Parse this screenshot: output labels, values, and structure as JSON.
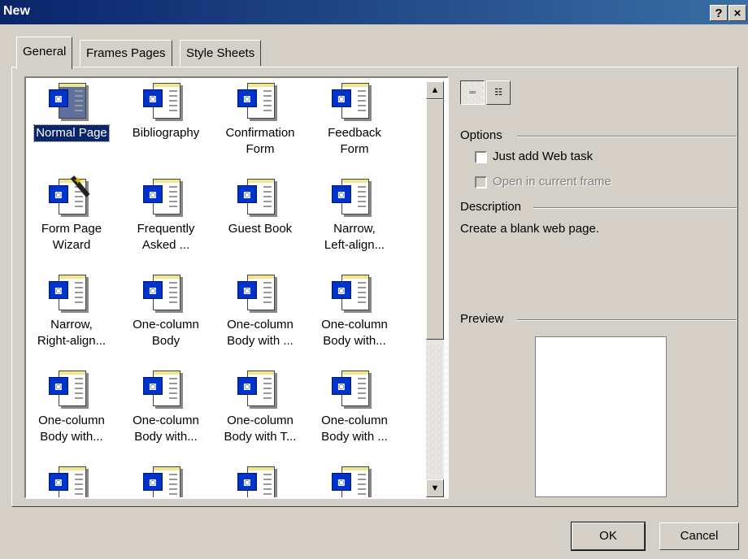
{
  "window": {
    "title": "New",
    "help_label": "?",
    "close_label": "×"
  },
  "tabs": [
    {
      "label": "General",
      "active": true
    },
    {
      "label": "Frames Pages",
      "active": false
    },
    {
      "label": "Style Sheets",
      "active": false
    }
  ],
  "templates": [
    {
      "label": "Normal Page",
      "selected": true,
      "icon": "normal-page-icon"
    },
    {
      "label": "Bibliography",
      "icon": "page-template-icon"
    },
    {
      "label": "Confirmation\nForm",
      "icon": "page-template-icon"
    },
    {
      "label": "Feedback\nForm",
      "icon": "page-template-icon"
    },
    {
      "label": "Form Page\nWizard",
      "icon": "wizard-icon"
    },
    {
      "label": "Frequently\nAsked ...",
      "icon": "page-template-icon"
    },
    {
      "label": "Guest Book",
      "icon": "page-template-icon"
    },
    {
      "label": "Narrow,\nLeft-align...",
      "icon": "page-template-icon"
    },
    {
      "label": "Narrow,\nRight-align...",
      "icon": "page-template-icon"
    },
    {
      "label": "One-column\nBody",
      "icon": "page-template-icon"
    },
    {
      "label": "One-column\nBody with ...",
      "icon": "page-template-icon"
    },
    {
      "label": "One-column\nBody with...",
      "icon": "page-template-icon"
    },
    {
      "label": "One-column\nBody with...",
      "icon": "page-template-icon"
    },
    {
      "label": "One-column\nBody with...",
      "icon": "page-template-icon"
    },
    {
      "label": "One-column\nBody with T...",
      "icon": "page-template-icon"
    },
    {
      "label": "One-column\nBody with ...",
      "icon": "page-template-icon"
    },
    {
      "label": "",
      "icon": "page-template-icon"
    },
    {
      "label": "",
      "icon": "page-template-icon"
    },
    {
      "label": "",
      "icon": "page-template-icon"
    },
    {
      "label": "",
      "icon": "page-template-icon"
    }
  ],
  "view_buttons": {
    "large_icons": "large-icons-view-icon",
    "details": "details-view-icon"
  },
  "options": {
    "heading": "Options",
    "just_add_web_task": {
      "label": "Just add Web task",
      "checked": false,
      "enabled": true
    },
    "open_in_current_frame": {
      "label": "Open in current frame",
      "checked": false,
      "enabled": false
    }
  },
  "description": {
    "heading": "Description",
    "text": "Create a blank web page."
  },
  "preview": {
    "heading": "Preview"
  },
  "buttons": {
    "ok": "OK",
    "cancel": "Cancel"
  },
  "colors": {
    "titlebar": "#0a246a",
    "dialog": "#d4d0c8",
    "selection": "#0a246a"
  }
}
